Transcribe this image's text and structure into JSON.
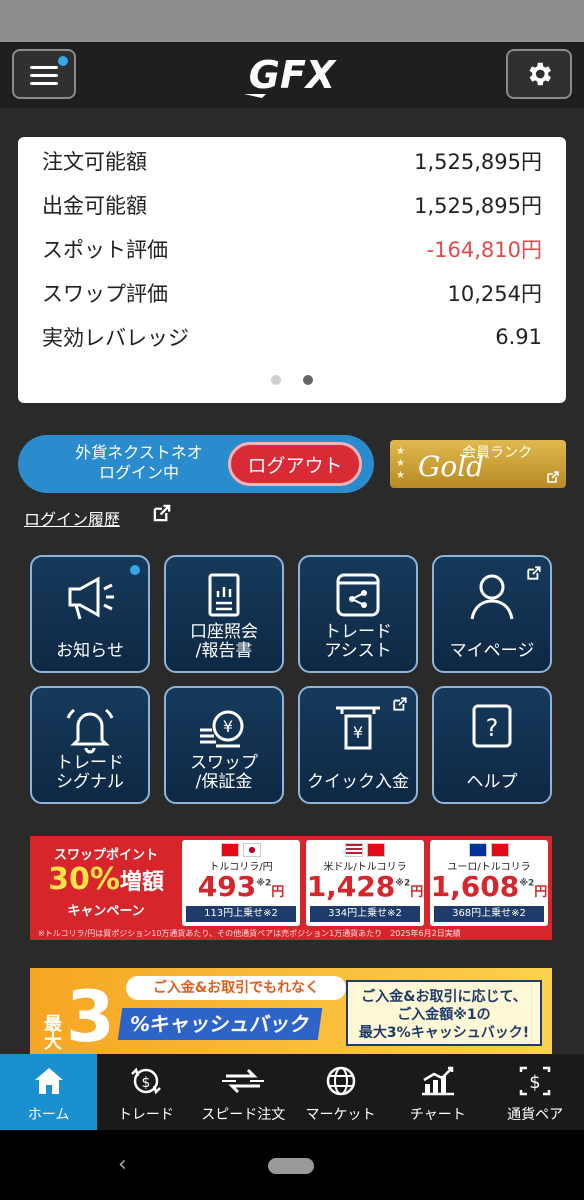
{
  "app": {
    "logo": "GFX"
  },
  "account": {
    "rows": [
      {
        "label": "注文可能額",
        "value": "1,525,895円"
      },
      {
        "label": "出金可能額",
        "value": "1,525,895円"
      },
      {
        "label": "スポット評価",
        "value": "-164,810円",
        "negative": true
      },
      {
        "label": "スワップ評価",
        "value": "10,254円"
      },
      {
        "label": "実効レバレッジ",
        "value": "6.91"
      }
    ],
    "page_index": 2,
    "page_count": 2
  },
  "login": {
    "status_line1": "外貨ネクストネオ",
    "status_line2": "ログイン中",
    "logout_label": "ログアウト",
    "history_label": "ログイン履歴"
  },
  "rank": {
    "title": "会員ランク",
    "level": "Gold"
  },
  "tiles": [
    {
      "label": "お知らせ",
      "icon": "megaphone-icon"
    },
    {
      "label": "口座照会\n/報告書",
      "icon": "report-icon"
    },
    {
      "label": "トレード\nアシスト",
      "icon": "share-icon"
    },
    {
      "label": "マイページ",
      "icon": "person-icon"
    },
    {
      "label": "トレード\nシグナル",
      "icon": "bell-icon"
    },
    {
      "label": "スワップ\n/保証金",
      "icon": "yen-coins-icon"
    },
    {
      "label": "クイック入金",
      "icon": "atm-icon"
    },
    {
      "label": "ヘルプ",
      "icon": "help-icon"
    }
  ],
  "banner_swap": {
    "title": "スワップポイント",
    "percent": "30%",
    "increase": "増額",
    "campaign": "キャンペーン",
    "pairs": [
      {
        "name": "トルコリラ/円",
        "price": "493",
        "mark": "円",
        "note": "※2",
        "foot": "113円上乗せ※2"
      },
      {
        "name": "米ドル/トルコリラ",
        "price": "1,428",
        "mark": "円",
        "note": "※2",
        "foot": "334円上乗せ※2"
      },
      {
        "name": "ユーロ/トルコリラ",
        "price": "1,608",
        "mark": "円",
        "note": "※2",
        "foot": "368円上乗せ※2"
      }
    ],
    "footnote": "※トルコリラ/円は買ポジション10万通貨あたり、その他通貨ペアは売ポジション1万通貨あたり　2025年6月2日実績"
  },
  "banner_cashback": {
    "headline": "ご入金&お取引でもれなく",
    "big": "3",
    "percent_text": "%キャッシュバック",
    "max_label": "最大",
    "right_text1": "ご入金&お取引に応じて、",
    "right_text2": "ご入金額※1の",
    "right_text3": "最大3%キャッシュバック!"
  },
  "tabs": [
    {
      "label": "ホーム",
      "icon": "home-icon",
      "active": true
    },
    {
      "label": "トレード",
      "icon": "trade-icon"
    },
    {
      "label": "スピード注文",
      "icon": "speed-order-icon"
    },
    {
      "label": "マーケット",
      "icon": "globe-icon"
    },
    {
      "label": "チャート",
      "icon": "chart-icon"
    },
    {
      "label": "通貨ペア",
      "icon": "currency-pair-icon"
    }
  ],
  "system_nav": {
    "back": "‹"
  }
}
